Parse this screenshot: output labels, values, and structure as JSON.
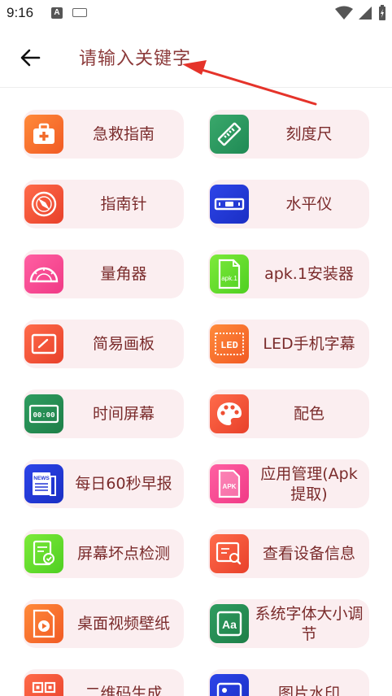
{
  "status_bar": {
    "time": "9:16",
    "a_label": "A"
  },
  "header": {
    "search_placeholder": "请输入关键字"
  },
  "tools": [
    {
      "label": "急救指南",
      "icon": "first-aid-kit-icon",
      "color": "#f26a2a"
    },
    {
      "label": "刻度尺",
      "icon": "ruler-icon",
      "color": "#2b9a5e"
    },
    {
      "label": "指南针",
      "icon": "compass-icon",
      "color": "#ee4f33"
    },
    {
      "label": "水平仪",
      "icon": "spirit-level-icon",
      "color": "#2237d6"
    },
    {
      "label": "量角器",
      "icon": "protractor-icon",
      "color": "#f54a93"
    },
    {
      "label": "apk.1安装器",
      "icon": "apk-file-icon",
      "color": "#63d92c",
      "icon_text": "apk.1"
    },
    {
      "label": "简易画板",
      "icon": "drawing-board-icon",
      "color": "#f0532f"
    },
    {
      "label": "LED手机字幕",
      "icon": "led-marquee-icon",
      "color": "#f26a2a",
      "icon_text": "LED"
    },
    {
      "label": "时间屏幕",
      "icon": "clock-screen-icon",
      "color": "#2b9a5e",
      "icon_text": "00:00"
    },
    {
      "label": "配色",
      "icon": "palette-icon",
      "color": "#ee4f33"
    },
    {
      "label": "每日60秒早报",
      "icon": "newspaper-icon",
      "color": "#2237d6",
      "icon_text": "NEWS"
    },
    {
      "label": "应用管理(Apk提取)",
      "icon": "apk-manager-icon",
      "color": "#f54a93",
      "icon_text": "APK"
    },
    {
      "label": "屏幕坏点检测",
      "icon": "screen-check-icon",
      "color": "#63d92c"
    },
    {
      "label": "查看设备信息",
      "icon": "device-info-icon",
      "color": "#f0532f"
    },
    {
      "label": "桌面视频壁纸",
      "icon": "video-wallpaper-icon",
      "color": "#f26a2a"
    },
    {
      "label": "系统字体大小调节",
      "icon": "font-size-icon",
      "color": "#2b9a5e",
      "icon_text": "Aa"
    },
    {
      "label": "二维码生成",
      "icon": "qr-code-icon",
      "color": "#ee4f33"
    },
    {
      "label": "图片水印",
      "icon": "image-watermark-icon",
      "color": "#2237d6"
    }
  ]
}
